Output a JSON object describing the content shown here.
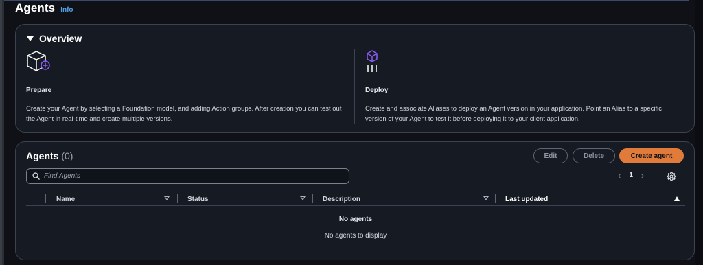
{
  "page": {
    "title": "Agents",
    "info_label": "Info"
  },
  "overview": {
    "title": "Overview",
    "prepare": {
      "icon": "cube-add-icon",
      "label": "Prepare",
      "description": "Create your Agent by selecting a Foundation model, and adding Action groups. After creation you can test out the Agent in real-time and create multiple versions."
    },
    "deploy": {
      "icon": "cube-deploy-icon",
      "label": "Deploy",
      "description": "Create and associate Aliases to deploy an Agent version in your application. Point an Alias to a specific version of your Agent to test it before deploying it to your client application."
    }
  },
  "agents": {
    "title": "Agents",
    "count": "(0)",
    "buttons": {
      "edit": "Edit",
      "delete": "Delete",
      "create": "Create agent"
    },
    "search": {
      "placeholder": "Find Agents",
      "value": ""
    },
    "pagination": {
      "current_page": "1",
      "prev": "‹",
      "next": "›"
    },
    "columns": [
      {
        "label": "Name"
      },
      {
        "label": "Status"
      },
      {
        "label": "Description"
      },
      {
        "label": "Last updated"
      }
    ],
    "empty": {
      "title": "No agents",
      "subtitle": "No agents to display"
    }
  },
  "colors": {
    "accent": "#e07b39",
    "link": "#539fe5",
    "icon_purple": "#8b5cf6",
    "panel_bg": "#161a22",
    "page_bg": "#0f1117"
  }
}
